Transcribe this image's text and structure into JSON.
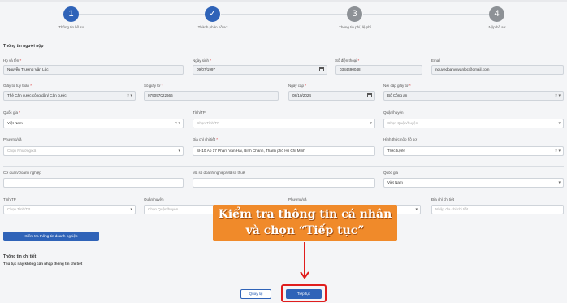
{
  "stepper": [
    {
      "num": "1",
      "label": "Thông tin hồ sơ",
      "state": "active"
    },
    {
      "num": "✓",
      "label": "Thành phần hồ sơ",
      "state": "done"
    },
    {
      "num": "3",
      "label": "Thông tin phí, lệ phí",
      "state": "pending"
    },
    {
      "num": "4",
      "label": "Nộp hồ sơ",
      "state": "pending"
    }
  ],
  "section_applicant": "Thông tin người nộp",
  "fields": {
    "ho_ten": {
      "label": "Họ và tên",
      "value": "Nguyễn Trương Vân Lộc"
    },
    "ngay_sinh": {
      "label": "Ngày sinh",
      "value": "09/07/1997"
    },
    "so_dien_thoai": {
      "label": "Số điện thoại",
      "value": "0384490048"
    },
    "email": {
      "label": "Email",
      "value": "nguyedoanvuvanloc@gmail.com"
    },
    "giay_to": {
      "label": "Giấy tờ tùy thân",
      "value": "Thẻ Căn cước công dân/ Căn cước"
    },
    "so_giay_to": {
      "label": "Số giấy tờ",
      "value": "079097022666"
    },
    "ngay_cap": {
      "label": "Ngày cấp",
      "value": "08/10/2024"
    },
    "noi_cap": {
      "label": "Nơi cấp giấy tờ",
      "value": "Bộ Công an"
    },
    "quoc_gia": {
      "label": "Quốc gia",
      "value": "Việt Nam"
    },
    "tinh_tp": {
      "label": "Tỉnh/TP",
      "placeholder": "Chọn Tỉnh/TP"
    },
    "quan_huyen": {
      "label": "Quận/huyện",
      "placeholder": "Chọn Quận/huyện"
    },
    "phuong_xa": {
      "label": "Phường/xã",
      "placeholder": "Chọn Phường/xã"
    },
    "dia_chi": {
      "label": "Địa chỉ chi tiết",
      "value": "SH10 Ấp 17 Phạm Văn Hai, Bình Chánh, Thành phố Hồ Chí Minh"
    },
    "hinh_thuc": {
      "label": "Hình thức nộp hồ sơ",
      "value": "Trực tuyến"
    },
    "co_quan": {
      "label": "Cơ quan/Doanh nghiệp",
      "value": ""
    },
    "ma_so_dn": {
      "label": "Mã số doanh nghiệp/Mã số thuế",
      "value": ""
    },
    "quoc_gia_dn": {
      "label": "Quốc gia",
      "value": "Việt Nam"
    },
    "tinh_tp_dn": {
      "label": "Tỉnh/TP",
      "placeholder": "Chọn Tỉnh/TP"
    },
    "quan_huyen_dn": {
      "label": "Quận/huyện",
      "placeholder": "Chọn Quận/huyện"
    },
    "phuong_xa_dn": {
      "label": "Phường/xã",
      "placeholder": ""
    },
    "dia_chi_dn": {
      "label": "Địa chỉ chi tiết",
      "placeholder": "Nhập địa chỉ chi tiết"
    }
  },
  "btn_check_dn": "Kiểm tra thông tin doanh nghiệp",
  "detail": {
    "title": "Thông tin chi tiết",
    "note": "Thủ tục này không cần nhập thông tin chi tiết"
  },
  "buttons": {
    "back": "Quay lại",
    "next": "Tiếp tục"
  },
  "callout": {
    "line1": "Kiểm tra thông tin cá nhân",
    "line2": "và chọn “Tiếp tục”"
  },
  "colors": {
    "primary": "#2f63b8",
    "callout": "#f08a2a",
    "highlight": "#e01e1e"
  }
}
